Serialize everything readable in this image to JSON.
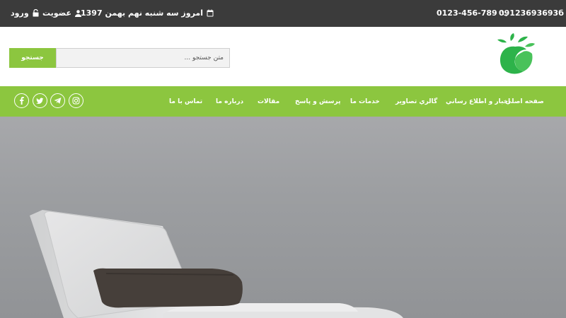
{
  "topbar": {
    "phone_mobile": "09123693693б",
    "phone_landline": "0123-456-789",
    "date_text": "امروز سه شنبه نهم بهمن 1397",
    "register_label": "عضويت",
    "login_label": "ورود"
  },
  "header": {
    "search_placeholder": "متن جستجو ...",
    "search_button_label": "جستجو"
  },
  "nav": {
    "items": [
      {
        "label": "صفحه اصلي"
      },
      {
        "label": "اخبار و اطلاع رساني"
      },
      {
        "label": "گالري تصاوير"
      },
      {
        "label": "خدمات ما"
      },
      {
        "label": "پرسش و پاسخ"
      },
      {
        "label": "مقالات"
      },
      {
        "label": "درباره ما"
      },
      {
        "label": "تماس با ما"
      }
    ],
    "social_icons": [
      "instagram-icon",
      "telegram-icon",
      "twitter-icon",
      "facebook-icon"
    ]
  },
  "colors": {
    "accent": "#8cc63f",
    "topbar_bg": "#3b3b3b",
    "hero_bg": "#9a9c9f"
  }
}
